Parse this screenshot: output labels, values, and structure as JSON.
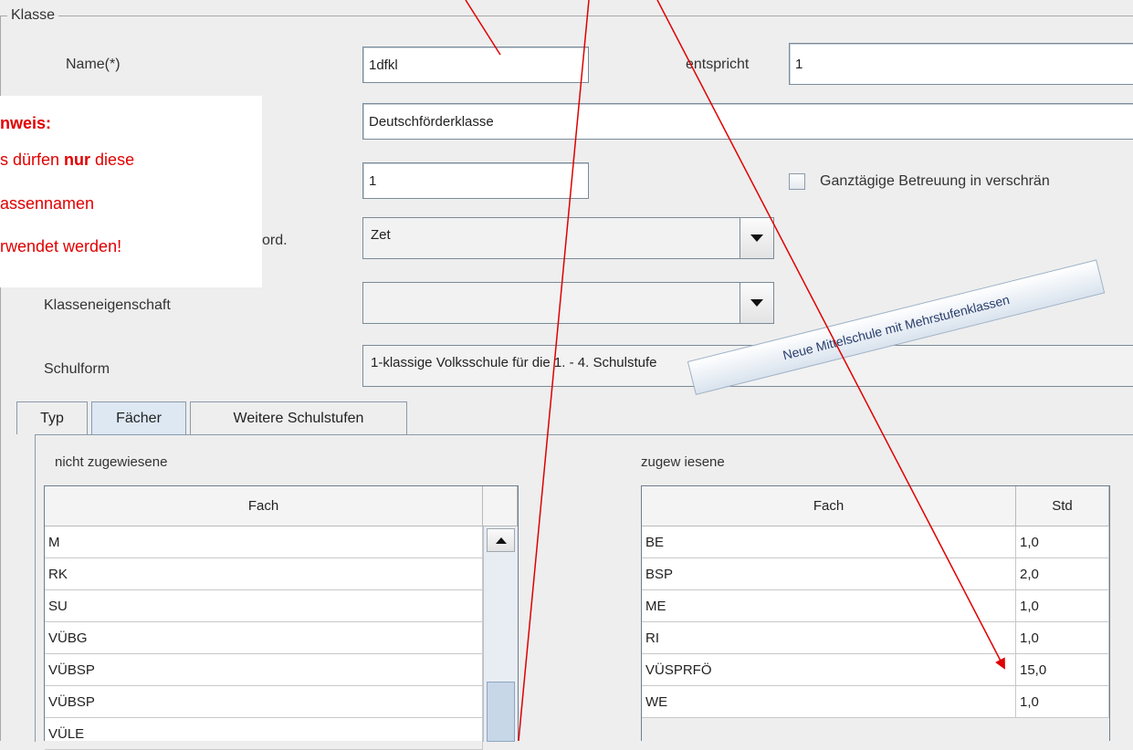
{
  "fieldset": {
    "legend": "Klasse"
  },
  "form": {
    "name_label": "Name(*)",
    "name_value": "1dfkl",
    "entspricht_label": "entspricht",
    "entspricht_value": "1",
    "description_value": "Deutschförderklasse",
    "schulstufe_value": "1",
    "ganztaegig_label": "Ganztägige Betreuung in verschrän",
    "ord_label": "ord.",
    "ord_value": "Zet",
    "klasseneigenschaft_label": "Klasseneigenschaft",
    "klasseneigenschaft_value": "",
    "schulform_label": "Schulform",
    "schulform_value": "1-klassige Volksschule für die 1. - 4. Schulstufe"
  },
  "note": {
    "title": "nweis:",
    "line1_a": "s dürfen ",
    "line1_b": "nur",
    "line1_c": " diese",
    "line2": "assennamen",
    "line3": "rwendet werden!"
  },
  "stamp": {
    "text": "Neue Mittelschule mit Mehrstufenklassen"
  },
  "tabs": [
    {
      "label": "Typ"
    },
    {
      "label": "Fächer"
    },
    {
      "label": "Weitere Schulstufen"
    }
  ],
  "left_table": {
    "title": "nicht zugewiesene",
    "header": "Fach",
    "rows": [
      "M",
      "RK",
      "SU",
      "VÜBG",
      "VÜBSP",
      "VÜBSP",
      "VÜLE"
    ]
  },
  "right_table": {
    "title": "zugew   iesene",
    "headers": [
      "Fach",
      "Std"
    ],
    "rows": [
      {
        "fach": "BE",
        "std": "1,0"
      },
      {
        "fach": "BSP",
        "std": "2,0"
      },
      {
        "fach": "ME",
        "std": "1,0"
      },
      {
        "fach": "RI",
        "std": "1,0"
      },
      {
        "fach": "VÜSPRFÖ",
        "std": "15,0"
      },
      {
        "fach": "WE",
        "std": "1,0"
      }
    ]
  },
  "colors": {
    "annotation_red": "#e00000",
    "tab_active": "#dde8f3"
  }
}
